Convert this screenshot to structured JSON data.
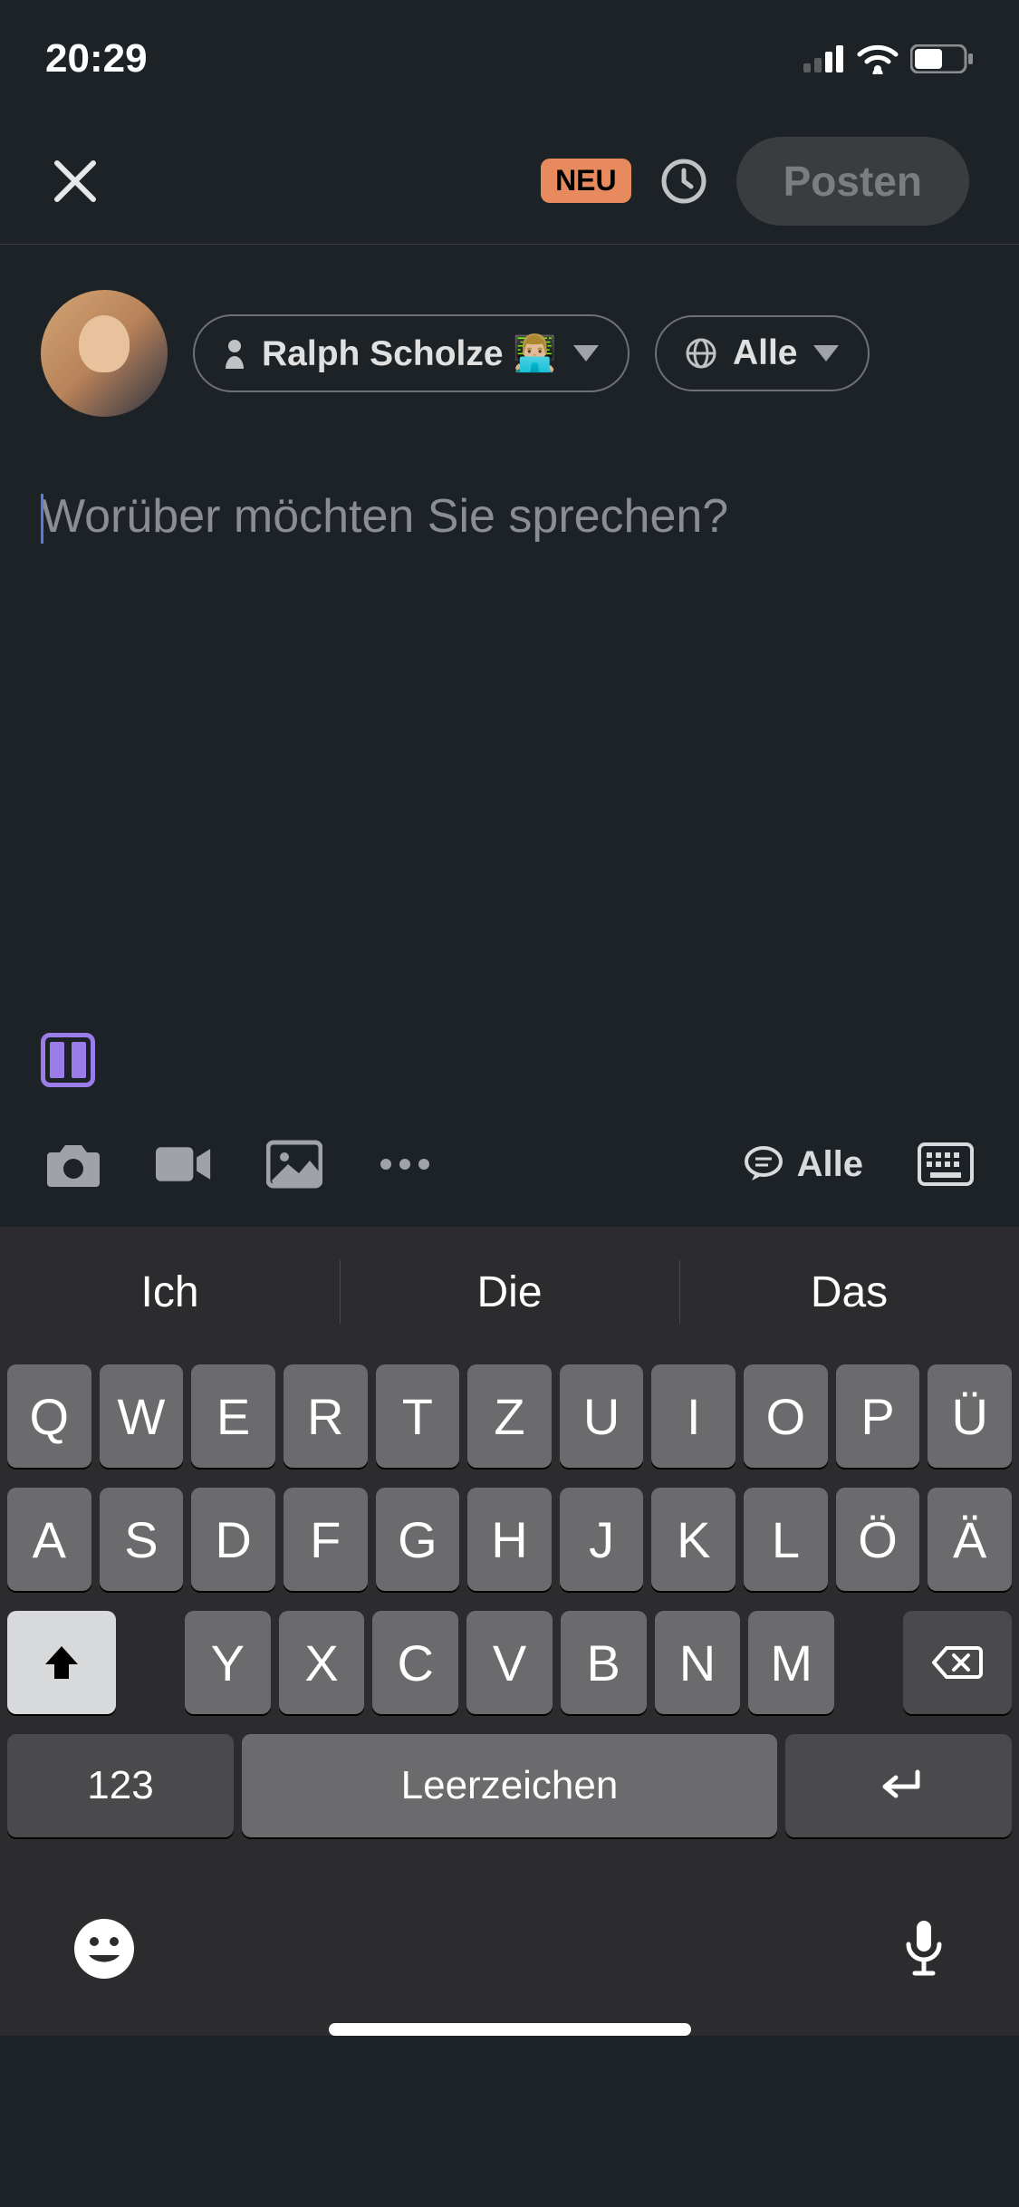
{
  "status": {
    "time": "20:29"
  },
  "header": {
    "neu_badge": "NEU",
    "post_label": "Posten"
  },
  "composer": {
    "author_chip_label": "Ralph Scholze 👨🏼‍💻",
    "audience_chip_label": "Alle",
    "placeholder": "Worüber möchten Sie sprechen?"
  },
  "toolbar": {
    "comment_audience_label": "Alle"
  },
  "keyboard": {
    "suggestions": [
      "Ich",
      "Die",
      "Das"
    ],
    "row1": [
      "Q",
      "W",
      "E",
      "R",
      "T",
      "Z",
      "U",
      "I",
      "O",
      "P",
      "Ü"
    ],
    "row2": [
      "A",
      "S",
      "D",
      "F",
      "G",
      "H",
      "J",
      "K",
      "L",
      "Ö",
      "Ä"
    ],
    "row3": [
      "Y",
      "X",
      "C",
      "V",
      "B",
      "N",
      "M"
    ],
    "num_key": "123",
    "space_key": "Leerzeichen"
  }
}
